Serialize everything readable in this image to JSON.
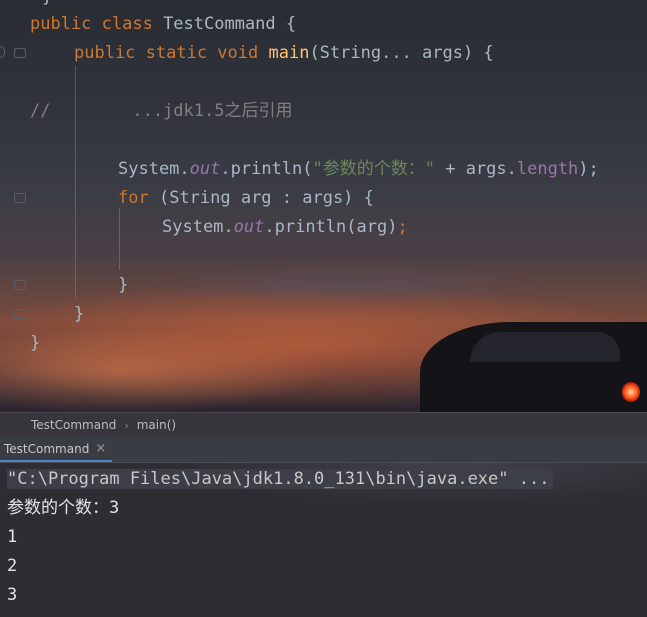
{
  "editor": {
    "line1": {
      "kw": "public class",
      "name": " TestCommand {"
    },
    "line2": {
      "kw": "public static void",
      "fn": "main",
      "rest": "(String... args) {"
    },
    "line3": {
      "comment": "//        ...jdk1.5之后引用"
    },
    "line4": {
      "a": "System.",
      "field": "out",
      "b": ".println(",
      "str": "\"参数的个数：\"",
      "c": " + args.",
      "prop": "length",
      "d": ");"
    },
    "line5": {
      "kw": "for",
      "rest": " (String arg : args) {"
    },
    "line6": {
      "a": "System.",
      "field": "out",
      "b": ".println(arg)",
      "semi": ";"
    },
    "line7": "}",
    "line8": "}",
    "line9": "}"
  },
  "breadcrumb": {
    "items": [
      "TestCommand",
      "main()"
    ],
    "separator": "›"
  },
  "run_panel": {
    "tab_label": "TestCommand",
    "close_glyph": "×",
    "console_lines": [
      "\"C:\\Program Files\\Java\\jdk1.8.0_131\\bin\\java.exe\" ...",
      "参数的个数：3",
      "1",
      "2",
      "3"
    ]
  },
  "icons": [
    "fold-marker-icon",
    "run-gutter-icon",
    "chevron-right-icon",
    "close-icon"
  ],
  "colors": {
    "keyword": "#cc7832",
    "method": "#ffc66d",
    "field": "#9876aa",
    "string": "#6a8759",
    "comment": "#808080",
    "text": "#a9b7c6",
    "tab_underline": "#4a88c7"
  }
}
